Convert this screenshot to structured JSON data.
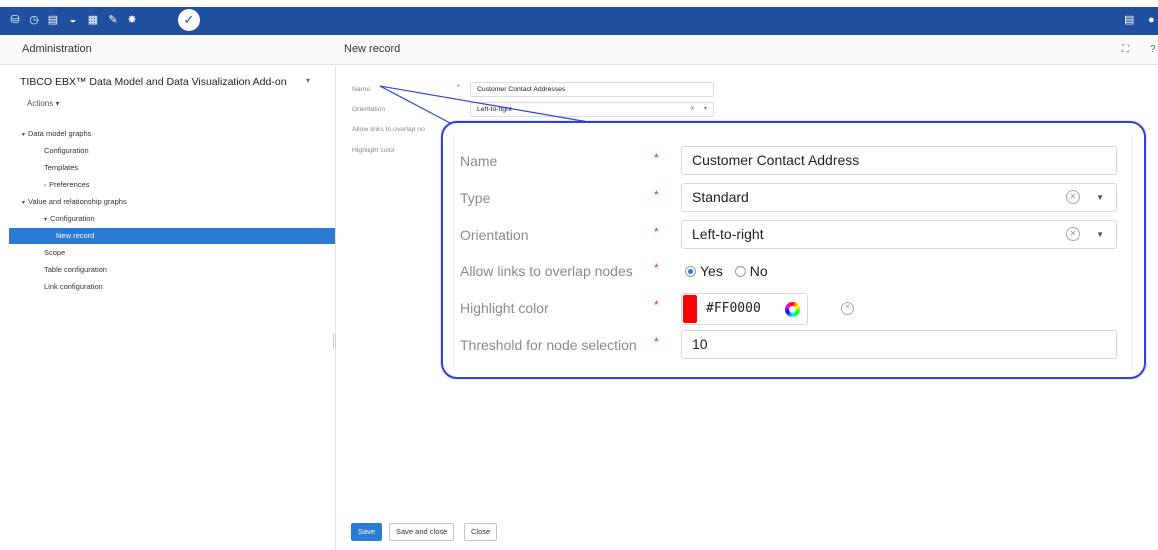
{
  "topbar": {
    "tools": [
      "database-icon",
      "clock-icon",
      "dataset-icon",
      "globe-icon",
      "table-icon",
      "edit-icon",
      "pin-icon"
    ],
    "active_tool": "wrench-icon"
  },
  "header": {
    "left_title": "Administration",
    "right_title": "New record"
  },
  "sidebar": {
    "addon_title": "TIBCO EBX™ Data Model and Data Visualization Add-on",
    "actions_label": "Actions ▾",
    "tree": [
      {
        "label": "Data model graphs",
        "level": 0,
        "toggle": "▾"
      },
      {
        "label": "Configuration",
        "level": 1,
        "toggle": ""
      },
      {
        "label": "Templates",
        "level": 1,
        "toggle": ""
      },
      {
        "label": "Preferences",
        "level": 1,
        "toggle": "›"
      },
      {
        "label": "Value and relationship graphs",
        "level": 0,
        "toggle": "▾"
      },
      {
        "label": "Configuration",
        "level": 1,
        "toggle": "▾"
      },
      {
        "label": "New record",
        "level": 2,
        "toggle": "",
        "selected": true
      },
      {
        "label": "Scope",
        "level": 1,
        "toggle": ""
      },
      {
        "label": "Table configuration",
        "level": 1,
        "toggle": ""
      },
      {
        "label": "Link configuration",
        "level": 1,
        "toggle": ""
      }
    ]
  },
  "small_form": {
    "name_label": "Name",
    "name_value": "Customer Contact Addresses",
    "orientation_label": "Orientation",
    "orientation_value": "Left-to-right",
    "overlap_label": "Allow links to overlap no",
    "highlight_label": "Highlight color",
    "required_mark": "*"
  },
  "callout_form": {
    "required_mark": "*",
    "fields": {
      "name": {
        "label": "Name",
        "value": "Customer Contact Address"
      },
      "type": {
        "label": "Type",
        "value": "Standard"
      },
      "orientation": {
        "label": "Orientation",
        "value": "Left-to-right"
      },
      "overlap": {
        "label": "Allow links to overlap nodes",
        "yes": "Yes",
        "no": "No",
        "selected": "Yes"
      },
      "highlight": {
        "label": "Highlight color",
        "value": "#FF0000",
        "swatch": "#ff0000"
      },
      "threshold": {
        "label": "Threshold for node selection",
        "value": "10"
      }
    }
  },
  "buttons": {
    "save": "Save",
    "save_close": "Save and close",
    "close": "Close"
  },
  "colors": {
    "topbar": "#1f4f9e",
    "selection": "#2b7bd6",
    "callout_border": "#2f44d6",
    "required": "#d9342b"
  }
}
